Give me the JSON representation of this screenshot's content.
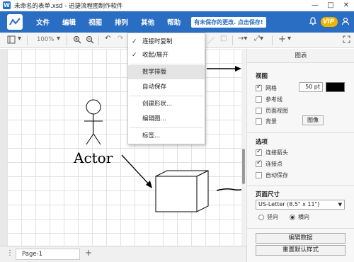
{
  "window": {
    "icon_glyph": "W",
    "title": "未命名的表单.xsd - 迅捷流程图制作软件",
    "controls": [
      "—",
      "□",
      "✕"
    ]
  },
  "menubar": {
    "items": [
      "文件",
      "编辑",
      "视图",
      "排列",
      "其他",
      "帮助"
    ],
    "unsaved_notice": "有未保存的更改. 点击保存!",
    "vip_label": "VIP",
    "accent_color": "#2a6ec4"
  },
  "toolbar": {
    "zoom": "100%",
    "icons": [
      "page-view-icon",
      "zoom-in-icon",
      "zoom-out-icon",
      "undo-icon",
      "redo-icon",
      "fill-icon",
      "shape-icon",
      "connector-icon",
      "waypoint-icon",
      "insert-icon",
      "fullscreen-icon"
    ]
  },
  "dropdown": {
    "items": [
      {
        "label": "连接时复制",
        "checked": true
      },
      {
        "label": "收起/展开",
        "checked": true
      },
      {
        "label": "数学排版",
        "checked": false,
        "highlighted": true
      },
      {
        "label": "自动保存",
        "checked": false
      },
      {
        "label": "创建形状...",
        "checked": false
      },
      {
        "label": "编辑图...",
        "checked": false
      },
      {
        "label": "标签...",
        "checked": false
      }
    ]
  },
  "canvas": {
    "actor_label": "Actor"
  },
  "sidebar": {
    "title": "图表",
    "view_section": "视图",
    "grid_label": "网格",
    "grid_checked": true,
    "grid_size": "50 pt",
    "guides_label": "参考线",
    "guides_checked": false,
    "page_view_label": "页面视图",
    "page_view_checked": false,
    "background_label": "背景",
    "background_checked": false,
    "image_button": "图像",
    "options_section": "选项",
    "connection_arrows_label": "连接箭头",
    "connection_arrows_checked": true,
    "connection_points_label": "连接点",
    "connection_points_checked": true,
    "autosave_label": "自动保存",
    "autosave_checked": false,
    "page_size_section": "页面尺寸",
    "page_size_value": "US-Letter (8.5\" x 11\")",
    "portrait_label": "竖向",
    "landscape_label": "横向",
    "orientation": "landscape",
    "edit_data_button": "编辑数据",
    "reset_style_button": "重置默认样式"
  },
  "pagebar": {
    "menu_glyph": "⋮",
    "page_tab": "Page-1",
    "add_glyph": "+"
  }
}
